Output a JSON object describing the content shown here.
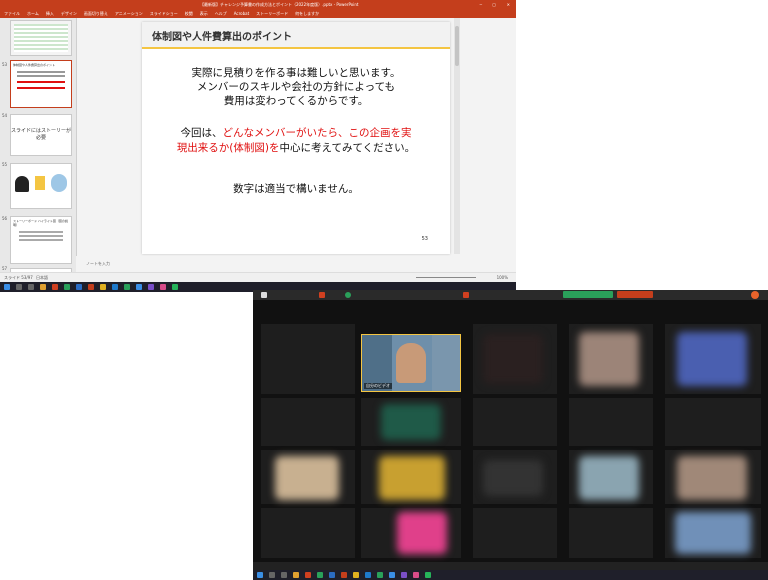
{
  "powerpoint": {
    "title": "【最新版】チャレンジ予算書の作成方法とポイント（2022年度版）.pptx - PowerPoint",
    "tabs": [
      "ファイル",
      "ホーム",
      "挿入",
      "デザイン",
      "画面切り替え",
      "アニメーション",
      "スライドショー",
      "校閲",
      "表示",
      "ヘルプ",
      "Acrobat",
      "ストーリーボード",
      "何をしますか"
    ],
    "thumbnails": [
      {
        "num": "53",
        "selected": true,
        "text": "体制図や人件費算出のポイント"
      },
      {
        "num": "54",
        "selected": false,
        "text": "スライドにはストーリーが必要"
      },
      {
        "num": "55",
        "selected": false,
        "text": ""
      },
      {
        "num": "56",
        "selected": false,
        "text": "ストーリーボード ハイライト図（図の説明）"
      },
      {
        "num": "57",
        "selected": false,
        "text": ""
      }
    ],
    "slide": {
      "title": "体制図や人件費算出のポイント",
      "line1": "実際に見積りを作る事は難しいと思います。",
      "line2": "メンバーのスキルや会社の方針によっても",
      "line3": "費用は変わってくるからです。",
      "line4_prefix": "今回は、",
      "line4_red": "どんなメンバーがいたら、この企画を実",
      "line5_red": "現出来るか(体制図)を",
      "line5_suffix": "中心に考えてみてください。",
      "line6": "数字は適当で構いません。",
      "page_number": "53"
    },
    "notes_placeholder": "ノートを入力",
    "status_left": "スライド 53/97",
    "status_lang": "日本語",
    "status_zoom": "100%"
  },
  "zoom": {
    "self_label": "自分のビデオ"
  },
  "colors": {
    "ppt_accent": "#c43e1c",
    "slide_red": "#e01010",
    "taskbar": "#1f1f2a",
    "zoom_bg": "#1a1a1a"
  }
}
